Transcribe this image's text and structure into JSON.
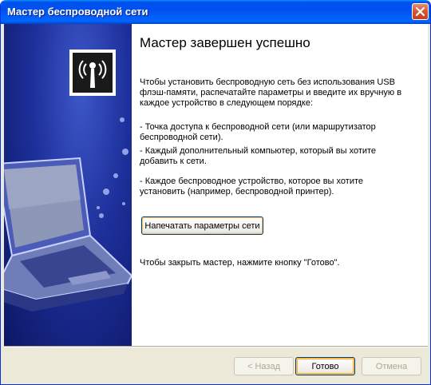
{
  "window": {
    "title": "Мастер беспроводной сети"
  },
  "icons": {
    "close": "close-icon",
    "wireless": "wireless-antenna-icon",
    "laptop": "laptop-illustration"
  },
  "content": {
    "heading": "Мастер завершен успешно",
    "intro": "Чтобы установить беспроводную сеть без использования USB флэш-памяти, распечатайте параметры и введите их вручную в каждое устройство в следующем порядке:",
    "steps": [
      "- Точка доступа к беспроводной сети (или маршрутизатор беспроводной сети).",
      "- Каждый дополнительный компьютер, который вы хотите добавить к сети.",
      "- Каждое беспроводное устройство, которое вы хотите установить (например, беспроводной принтер)."
    ],
    "print_button": "Напечатать параметры сети",
    "close_hint": "Чтобы закрыть мастер, нажмите кнопку \"Готово\"."
  },
  "buttons": {
    "back": "< Назад",
    "finish": "Готово",
    "cancel": "Отмена"
  },
  "colors": {
    "titlebar": "#0054e3",
    "left_panel": "#1d2f9a",
    "dialog_bg": "#ece9d8",
    "close_button": "#d65532"
  }
}
